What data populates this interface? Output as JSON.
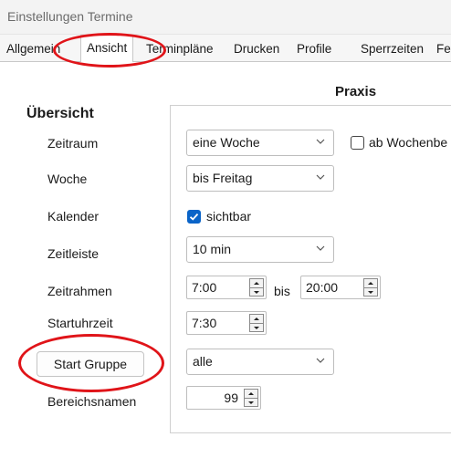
{
  "window": {
    "title": "Einstellungen Termine"
  },
  "tabs": [
    {
      "label": "Allgemein"
    },
    {
      "label": "Ansicht",
      "active": true
    },
    {
      "label": "Terminpläne"
    },
    {
      "label": "Drucken"
    },
    {
      "label": "Profile"
    },
    {
      "label": "Sperrzeiten"
    },
    {
      "label": "Fe"
    }
  ],
  "section": {
    "title": "Übersicht",
    "column_header": "Praxis"
  },
  "rows": {
    "zeitraum": {
      "label": "Zeitraum",
      "value": "eine Woche",
      "checkbox_label": "ab Wochenbe",
      "checkbox_checked": false
    },
    "woche": {
      "label": "Woche",
      "value": "bis Freitag"
    },
    "kalender": {
      "label": "Kalender",
      "checkbox_label": "sichtbar",
      "checkbox_checked": true
    },
    "zeitleiste": {
      "label": "Zeitleiste",
      "value": "10 min"
    },
    "zeitrahmen": {
      "label": "Zeitrahmen",
      "from": "7:00",
      "separator": "bis",
      "to": "20:00"
    },
    "startuhrzeit": {
      "label": "Startuhrzeit",
      "value": "7:30"
    },
    "start_gruppe": {
      "button_label": "Start Gruppe",
      "value": "alle"
    },
    "bereichsnamen": {
      "label": "Bereichsnamen",
      "value": "99"
    }
  },
  "annotations": {
    "color": "#e01419",
    "shape": "ellipse"
  },
  "colors": {
    "checkbox_checked": "#0a64c8"
  }
}
